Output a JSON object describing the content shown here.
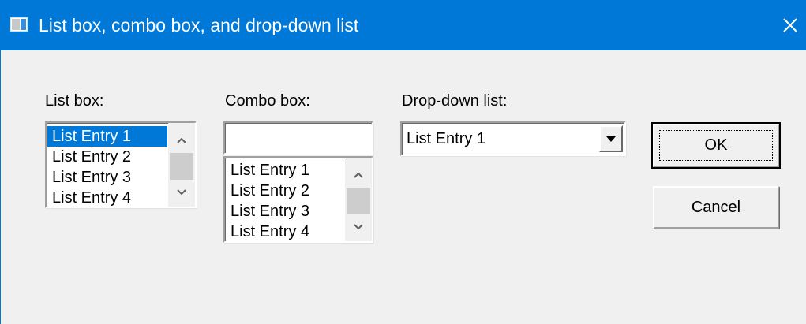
{
  "window": {
    "title": "List box, combo box, and drop-down list",
    "title_bar_color": "#0078d7",
    "icons": {
      "app": "app-window-icon",
      "close": "close-icon"
    }
  },
  "list_box": {
    "label": "List box:",
    "items": [
      "List Entry 1",
      "List Entry 2",
      "List Entry 3",
      "List Entry 4"
    ],
    "selected_index": 0,
    "selection_color": "#0078d7"
  },
  "combo_box": {
    "label": "Combo box:",
    "edit_value": "",
    "items": [
      "List Entry 1",
      "List Entry 2",
      "List Entry 3",
      "List Entry 4"
    ]
  },
  "dropdown_list": {
    "label": "Drop-down list:",
    "selected_value": "List Entry 1"
  },
  "buttons": {
    "ok": "OK",
    "cancel": "Cancel"
  }
}
